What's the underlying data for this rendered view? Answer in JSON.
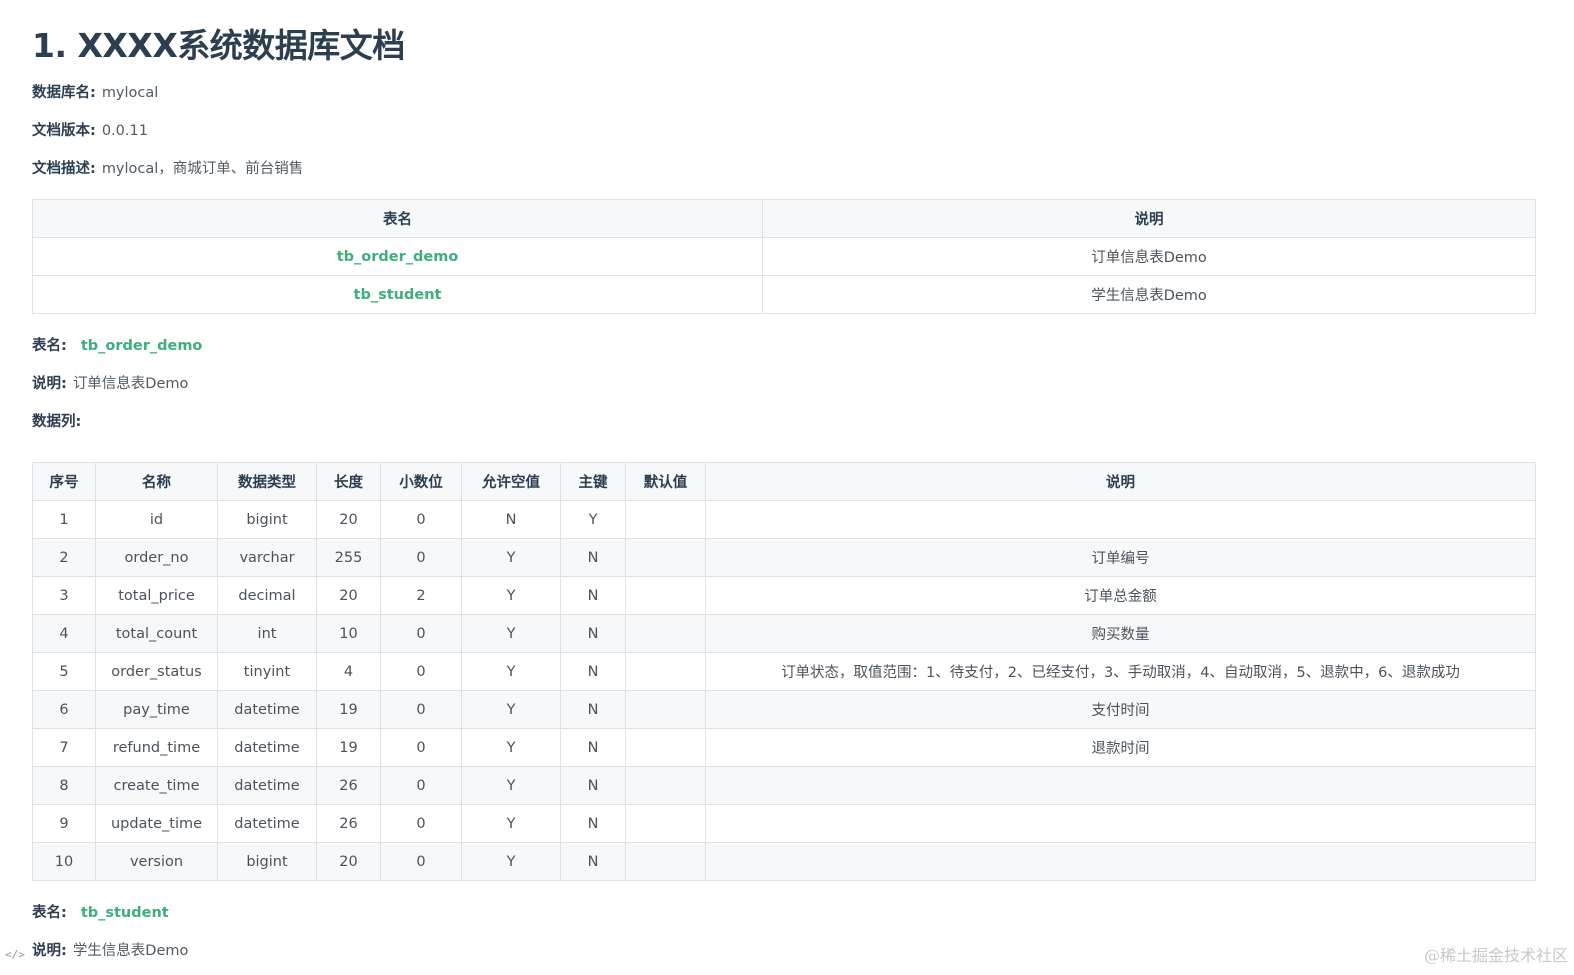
{
  "doc": {
    "title": "1. XXXX系统数据库文档",
    "meta": [
      {
        "label": "数据库名:",
        "value": "mylocal"
      },
      {
        "label": "文档版本:",
        "value": "0.0.11"
      },
      {
        "label": "文档描述:",
        "value": "mylocal，商城订单、前台销售"
      }
    ]
  },
  "toc": {
    "headers": [
      "表名",
      "说明"
    ],
    "rows": [
      {
        "name": "tb_order_demo",
        "desc": "订单信息表Demo"
      },
      {
        "name": "tb_student",
        "desc": "学生信息表Demo"
      }
    ]
  },
  "table1": {
    "name_label": "表名:",
    "name": "tb_order_demo",
    "desc_label": "说明:",
    "desc": "订单信息表Demo",
    "cols_label": "数据列:",
    "headers": [
      "序号",
      "名称",
      "数据类型",
      "长度",
      "小数位",
      "允许空值",
      "主键",
      "默认值",
      "说明"
    ],
    "rows": [
      [
        "1",
        "id",
        "bigint",
        "20",
        "0",
        "N",
        "Y",
        "",
        ""
      ],
      [
        "2",
        "order_no",
        "varchar",
        "255",
        "0",
        "Y",
        "N",
        "",
        "订单编号"
      ],
      [
        "3",
        "total_price",
        "decimal",
        "20",
        "2",
        "Y",
        "N",
        "",
        "订单总金额"
      ],
      [
        "4",
        "total_count",
        "int",
        "10",
        "0",
        "Y",
        "N",
        "",
        "购买数量"
      ],
      [
        "5",
        "order_status",
        "tinyint",
        "4",
        "0",
        "Y",
        "N",
        "",
        "订单状态，取值范围：1、待支付，2、已经支付，3、手动取消，4、自动取消，5、退款中，6、退款成功"
      ],
      [
        "6",
        "pay_time",
        "datetime",
        "19",
        "0",
        "Y",
        "N",
        "",
        "支付时间"
      ],
      [
        "7",
        "refund_time",
        "datetime",
        "19",
        "0",
        "Y",
        "N",
        "",
        "退款时间"
      ],
      [
        "8",
        "create_time",
        "datetime",
        "26",
        "0",
        "Y",
        "N",
        "",
        ""
      ],
      [
        "9",
        "update_time",
        "datetime",
        "26",
        "0",
        "Y",
        "N",
        "",
        ""
      ],
      [
        "10",
        "version",
        "bigint",
        "20",
        "0",
        "Y",
        "N",
        "",
        ""
      ]
    ]
  },
  "table2": {
    "name_label": "表名:",
    "name": "tb_student",
    "desc_label": "说明:",
    "desc": "学生信息表Demo"
  },
  "corner_icon": "</>",
  "watermark": "@稀土掘金技术社区"
}
